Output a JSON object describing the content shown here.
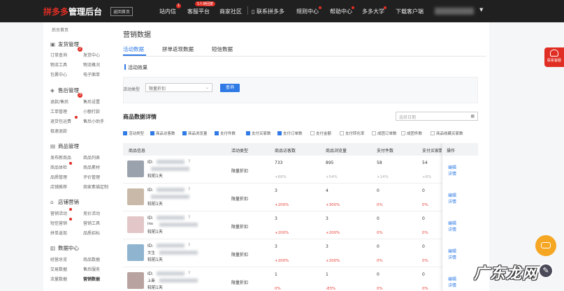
{
  "topbar": {
    "logo": "拼多多",
    "logo_sub": "管理后台",
    "back_home": "返回首页",
    "nav": [
      {
        "label": "站内信",
        "badge": "1"
      },
      {
        "label": "客服平台",
        "pill": "5人待回复"
      },
      {
        "label": "商家社区"
      },
      {
        "label": "联系拼多多"
      },
      {
        "label": "规则中心"
      },
      {
        "label": "帮助中心"
      },
      {
        "label": "多多大学"
      },
      {
        "label": "下载客户端"
      }
    ]
  },
  "sidebar": {
    "home": "后台首页",
    "sections": [
      {
        "title": "发货管理",
        "badge": "2",
        "items": [
          "订单查询",
          "发货中心",
          "物流工具",
          "物流概况",
          "包裹中心",
          "电子面单"
        ]
      },
      {
        "title": "售后管理",
        "badge": "3",
        "items": [
          "退款/售后",
          "售后设置",
          "工单管理",
          "小额打款",
          "退货包运费",
          "售后小助手",
          "极速退款"
        ]
      },
      {
        "title": "商品管理",
        "items": [
          "发布新商品",
          "商品列表",
          "商品体检",
          "商品素材",
          "品质管理",
          "评价管理",
          "店铺推荐",
          "商家素描定制"
        ]
      },
      {
        "title": "店铺营销",
        "items": [
          "营销活动",
          "竞价活动",
          "短信营销",
          "营销工具",
          "拼单返现",
          "品质招标"
        ]
      },
      {
        "title": "数据中心",
        "items": [
          "经营总览",
          "商品数据",
          "交易数据",
          "售后服务",
          "流量数据",
          "营销数据"
        ]
      }
    ]
  },
  "main": {
    "page_title": "营销数据",
    "tabs": [
      "活动数据",
      "拼单返现数据",
      "短信数据"
    ],
    "section_title": "活动效果",
    "filter_label": "活动类型",
    "filter_value": "限量折扣",
    "query_button": "查询",
    "detail_title": "商品数据详情",
    "date_placeholder": "选择日期",
    "metrics": [
      {
        "label": "活动类型",
        "checked": true
      },
      {
        "label": "商品访客数",
        "checked": true
      },
      {
        "label": "商品浏览量",
        "checked": true
      },
      {
        "label": "支付件数",
        "checked": true
      },
      {
        "label": "支付买家数",
        "checked": true
      },
      {
        "label": "支付订单数",
        "checked": true
      },
      {
        "label": "支付金额",
        "checked": false
      },
      {
        "label": "支付转化率",
        "checked": false
      },
      {
        "label": "成团订单数",
        "checked": false
      },
      {
        "label": "成团件数",
        "checked": false
      },
      {
        "label": "商品收藏买家数",
        "checked": false
      }
    ],
    "table": {
      "headers": [
        "商品信息",
        "活动类型",
        "商品访客数",
        "商品浏览量",
        "支付件数",
        "支付买家数",
        "操作"
      ],
      "rows": [
        {
          "id_prefix": "ID:",
          "cat": "",
          "posted": "较前1天",
          "type": "限量折扣",
          "visitors": "733",
          "visitors_chg": "+68%",
          "views": "895",
          "views_chg": "+54%",
          "pieces": "58",
          "pieces_chg": "+14%",
          "buyers": "54",
          "buyers_chg": "+6%",
          "chg_red": false
        },
        {
          "id_prefix": "ID:",
          "cat": "",
          "posted": "较前1天",
          "type": "限量折扣",
          "visitors": "3",
          "visitors_chg": "+200%",
          "views": "4",
          "views_chg": "+300%",
          "pieces": "0",
          "pieces_chg": "0%",
          "buyers": "0",
          "buyers_chg": "0%",
          "chg_red": true
        },
        {
          "id_prefix": "ID:",
          "cat": "ins",
          "posted": "较前1天",
          "type": "限量折扣",
          "visitors": "3",
          "visitors_chg": "+200%",
          "views": "3",
          "views_chg": "+200%",
          "pieces": "0",
          "pieces_chg": "0%",
          "buyers": "0",
          "buyers_chg": "0%",
          "chg_red": true
        },
        {
          "id_prefix": "ID:",
          "cat": "文生",
          "posted": "较前1天",
          "type": "限量折扣",
          "visitors": "3",
          "visitors_chg": "+200%",
          "views": "3",
          "views_chg": "+200%",
          "pieces": "0",
          "pieces_chg": "0%",
          "buyers": "0",
          "buyers_chg": "0%",
          "chg_red": true
        },
        {
          "id_prefix": "ID:",
          "cat": "上新",
          "posted": "较前1天",
          "type": "限量折扣",
          "visitors": "1",
          "visitors_chg": "0%",
          "views": "1",
          "views_chg": "-83%",
          "pieces": "0",
          "pieces_chg": "0%",
          "buyers": "0",
          "buyers_chg": "0%",
          "chg_red": true
        }
      ],
      "op_links": [
        "编辑",
        "详情"
      ]
    }
  },
  "float": {
    "contact": "联系客服"
  },
  "watermark": "广东龙网",
  "colors": {
    "accent": "#2f7ae5",
    "brand": "#e02e24",
    "topbar": "#202020"
  }
}
